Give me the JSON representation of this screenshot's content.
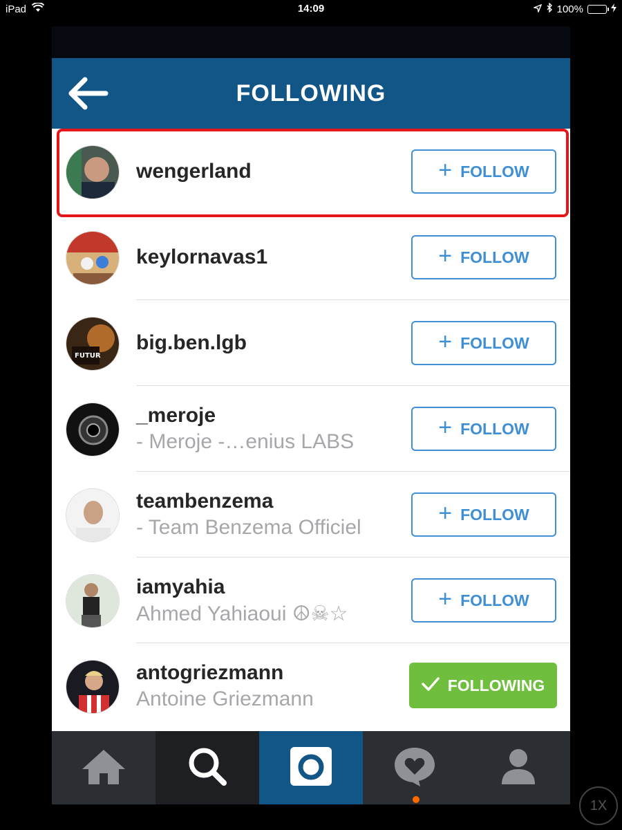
{
  "statusbar": {
    "device": "iPad",
    "time": "14:09",
    "battery": "100%"
  },
  "header": {
    "title": "FOLLOWING"
  },
  "users": [
    {
      "username": "wengerland",
      "fullname": "",
      "button": "FOLLOW",
      "state": "follow"
    },
    {
      "username": "keylornavas1",
      "fullname": "",
      "button": "FOLLOW",
      "state": "follow"
    },
    {
      "username": "big.ben.lgb",
      "fullname": "",
      "button": "FOLLOW",
      "state": "follow"
    },
    {
      "username": "_meroje",
      "fullname": "- Meroje -…enius LABS",
      "button": "FOLLOW",
      "state": "follow"
    },
    {
      "username": "teambenzema",
      "fullname": "- Team Benzema Officiel",
      "button": "FOLLOW",
      "state": "follow"
    },
    {
      "username": "iamyahia",
      "fullname": "Ahmed Yahiaoui ☮☠☆",
      "button": "FOLLOW",
      "state": "follow"
    },
    {
      "username": "antogriezmann",
      "fullname": "Antoine Griezmann",
      "button": "FOLLOWING",
      "state": "following"
    }
  ],
  "tabs": [
    "home",
    "search",
    "camera",
    "activity",
    "profile"
  ],
  "zoom": "1X",
  "colors": {
    "header": "#125688",
    "follow": "#3f8fd6",
    "following": "#6fbe3d",
    "highlight": "#e3161c"
  }
}
